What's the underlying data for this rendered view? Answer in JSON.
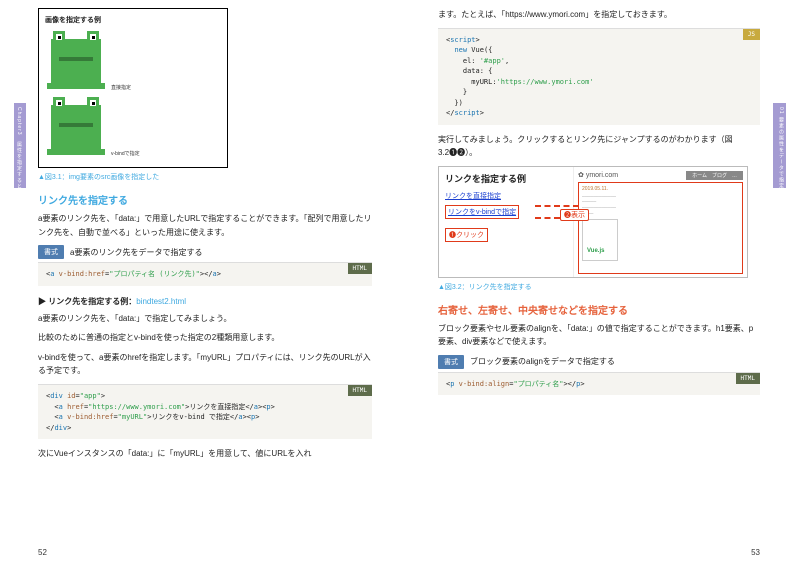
{
  "left": {
    "side_tab": "Chapter3　属性を指定するとき",
    "frog_box_title": "画像を指定する例",
    "frog_label1": "直接指定",
    "frog_label2": "v-bindで指定",
    "caption": "▲図3.1：img要素のsrc画像を指定した",
    "h2_link": "リンク先を指定する",
    "p1": "a要素のリンク先を、「data:」で用意したURLで指定することができます。「配列で用意したリンク先を、自動で並べる」といった用途に使えます。",
    "format_chip": "書式",
    "format_desc1": "a要素のリンク先をデータで指定する",
    "code1": "<a v-bind:href=\"プロパティ名 (リンク先)\"></a>",
    "example_label": "▶ リンク先を指定する例：",
    "example_fn": "bindtest2.html",
    "p2a": "a要素のリンク先を、「data:」で指定してみましょう。",
    "p2b": "比較のために普通の指定とv-bindを使った指定の2種類用意します。",
    "p2c": "v-bindを使って、a要素のhrefを指定します。「myURL」プロパティには、リンク先のURLが入る予定です。",
    "code2_l1": "<div id=\"app\">",
    "code2_l2": "  <a href=\"https://www.ymori.com\">リンクを直接指定</a><p>",
    "code2_l3": "  <a v-bind:href=\"myURL\">リンクをv-bind で指定</a><p>",
    "code2_l4": "</div>",
    "p3": "次にVueインスタンスの「data:」に「myURL」を用意して、値にURLを入れ",
    "pagenum": "52"
  },
  "right": {
    "side_tab": "01 要素の属性をデータで指定する：v-bind",
    "p_top": "ます。たとえば、「https://www.ymori.com」を指定しておきます。",
    "code_r1": "<script>",
    "code_r2": "  new Vue({",
    "code_r3": "    el: '#app',",
    "code_r4": "    data: {",
    "code_r5": "      myURL:'https://www.ymori.com'",
    "code_r6": "    }",
    "code_r7": "  })",
    "code_r8": "</script>",
    "p_exec": "実行してみましょう。クリックするとリンク先にジャンプするのがわかります（図3.2❶❷）。",
    "browser_title": "リンクを指定する例",
    "link1": "リンクを直接指定",
    "link2": "リンクをv-bindで指定",
    "click_badge": "❶クリック",
    "site_name": "ymori.com",
    "disp_badge": "❷表示",
    "caption_r": "▲図3.2：リンク先を指定する",
    "h2_align": "右寄せ、左寄せ、中央寄せなどを指定する",
    "p_align": "ブロック要素やセル要素のalignを、「data:」の値で指定することができます。h1要素、p要素、div要素などで使えます。",
    "format_desc2": "ブロック要素のalignをデータで指定する",
    "code_align": "<p v-bind:align=\"プロパティ名\"></p>",
    "pagenum": "53",
    "html_tag": "HTML",
    "js_tag": "JS"
  }
}
